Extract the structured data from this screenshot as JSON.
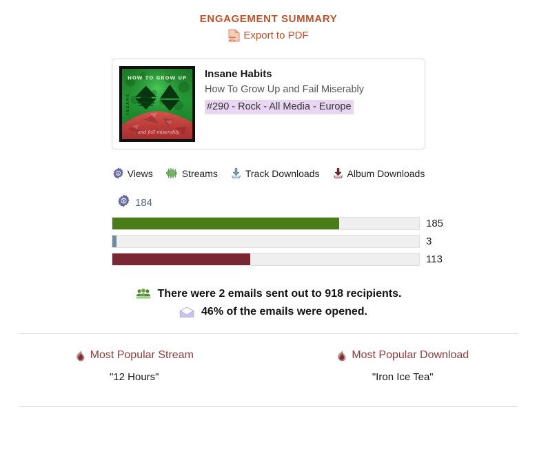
{
  "header": {
    "title": "ENGAGEMENT SUMMARY",
    "export_label": "Export to PDF",
    "export_icon": "pdf-file-icon",
    "accent_color": "#c0522a"
  },
  "release_card": {
    "artist": "Insane Habits",
    "album_title": "How To Grow Up and Fail Miserably",
    "tagline": "#290 - Rock - All Media - Europe",
    "tagline_highlight_color": "#e8d6f3",
    "artwork": {
      "alt": "How To Grow Up album cover",
      "top_text": "HOW TO GROW UP",
      "side_text": "INSANE",
      "bottom_script": "and fail miserably",
      "top_color": "#1f8a2e",
      "bottom_color": "#c5443f",
      "border_color": "#111111"
    }
  },
  "legend": {
    "items": [
      {
        "label": "Views",
        "icon": "views-gear-eye-icon",
        "color": "#6a6fa8"
      },
      {
        "label": "Streams",
        "icon": "waveform-icon",
        "color": "#3f8f2f"
      },
      {
        "label": "Track Downloads",
        "icon": "download-tray-icon",
        "color": "#6f8ba3"
      },
      {
        "label": "Album Downloads",
        "icon": "download-tray-icon",
        "color": "#7a2733"
      }
    ]
  },
  "stats": {
    "views_icon": "views-gear-eye-icon",
    "views_count": "184",
    "bars": [
      {
        "name": "streams",
        "value": "185",
        "fill_color": "#4a7c17",
        "fill_percent": 74
      },
      {
        "name": "track-downloads",
        "value": "3",
        "fill_color": "#6f8ba3",
        "fill_percent": 1.3
      },
      {
        "name": "album-downloads",
        "value": "113",
        "fill_color": "#7a2733",
        "fill_percent": 45
      }
    ]
  },
  "email_summary": {
    "recipients_icon": "people-group-icon",
    "recipients_text": "There were 2 emails sent out to 918 recipients.",
    "opened_icon": "envelope-open-icon",
    "opened_text": "46% of the emails were opened."
  },
  "popular": {
    "stream": {
      "icon": "flame-icon",
      "heading": "Most Popular Stream",
      "value": "\"12 Hours\""
    },
    "download": {
      "icon": "flame-icon",
      "heading": "Most Popular Download",
      "value": "\"Iron Ice Tea\""
    },
    "heading_color": "#8f3b3b"
  },
  "chart_data": {
    "type": "bar",
    "title": "Engagement Summary",
    "orientation": "horizontal",
    "categories": [
      "Streams",
      "Track Downloads",
      "Album Downloads"
    ],
    "values": [
      185,
      3,
      113
    ],
    "colors": [
      "#4a7c17",
      "#6f8ba3",
      "#7a2733"
    ],
    "xlabel": "",
    "ylabel": "",
    "xlim": [
      0,
      250
    ],
    "grid": false,
    "legend_position": "top",
    "annotations": [
      "Views: 184"
    ]
  }
}
